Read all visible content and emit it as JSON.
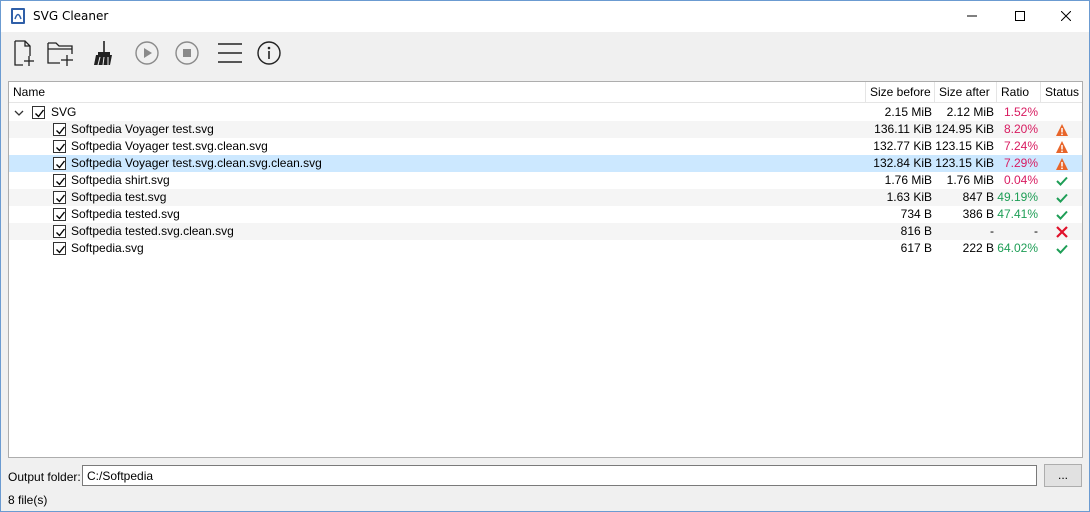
{
  "window": {
    "title": "SVG Cleaner"
  },
  "toolbar": {
    "buttons": [
      {
        "name": "add-files",
        "icon": "file-plus-icon"
      },
      {
        "name": "add-folder",
        "icon": "folder-plus-icon"
      },
      {
        "name": "clear-list",
        "icon": "broom-icon"
      },
      {
        "name": "start",
        "icon": "play-circle-icon"
      },
      {
        "name": "stop",
        "icon": "stop-circle-icon"
      },
      {
        "name": "menu",
        "icon": "hamburger-icon"
      },
      {
        "name": "about",
        "icon": "info-circle-icon"
      }
    ]
  },
  "table": {
    "columns": [
      "Name",
      "Size before",
      "Size after",
      "Ratio",
      "Status"
    ],
    "root": {
      "name": "SVG",
      "size_before": "2.15 MiB",
      "size_after": "2.12 MiB",
      "ratio": "1.52%",
      "ratio_color": "red"
    },
    "rows": [
      {
        "name": "Softpedia Voyager test.svg",
        "size_before": "136.11 KiB",
        "size_after": "124.95 KiB",
        "ratio": "8.20%",
        "ratio_color": "red",
        "status": "warning"
      },
      {
        "name": "Softpedia Voyager test.svg.clean.svg",
        "size_before": "132.77 KiB",
        "size_after": "123.15 KiB",
        "ratio": "7.24%",
        "ratio_color": "red",
        "status": "warning"
      },
      {
        "name": "Softpedia Voyager test.svg.clean.svg.clean.svg",
        "size_before": "132.84 KiB",
        "size_after": "123.15 KiB",
        "ratio": "7.29%",
        "ratio_color": "red",
        "status": "warning"
      },
      {
        "name": "Softpedia shirt.svg",
        "size_before": "1.76 MiB",
        "size_after": "1.76 MiB",
        "ratio": "0.04%",
        "ratio_color": "red",
        "status": "ok"
      },
      {
        "name": "Softpedia test.svg",
        "size_before": "1.63 KiB",
        "size_after": "847 B",
        "ratio": "49.19%",
        "ratio_color": "green",
        "status": "ok"
      },
      {
        "name": "Softpedia tested.svg",
        "size_before": "734 B",
        "size_after": "386 B",
        "ratio": "47.41%",
        "ratio_color": "green",
        "status": "ok"
      },
      {
        "name": "Softpedia tested.svg.clean.svg",
        "size_before": "816 B",
        "size_after": "-",
        "ratio": "-",
        "ratio_color": "black",
        "status": "error"
      },
      {
        "name": "Softpedia.svg",
        "size_before": "617 B",
        "size_after": "222 B",
        "ratio": "64.02%",
        "ratio_color": "green",
        "status": "ok"
      }
    ]
  },
  "output": {
    "label": "Output folder:",
    "value": "C:/Softpedia",
    "browse_label": "..."
  },
  "statusbar": {
    "text": "8 file(s)"
  },
  "colors": {
    "red": "#d81b60",
    "green": "#1e9e56",
    "warning": "#e8652a",
    "error": "#e0102a",
    "selection": "#cce8ff"
  }
}
